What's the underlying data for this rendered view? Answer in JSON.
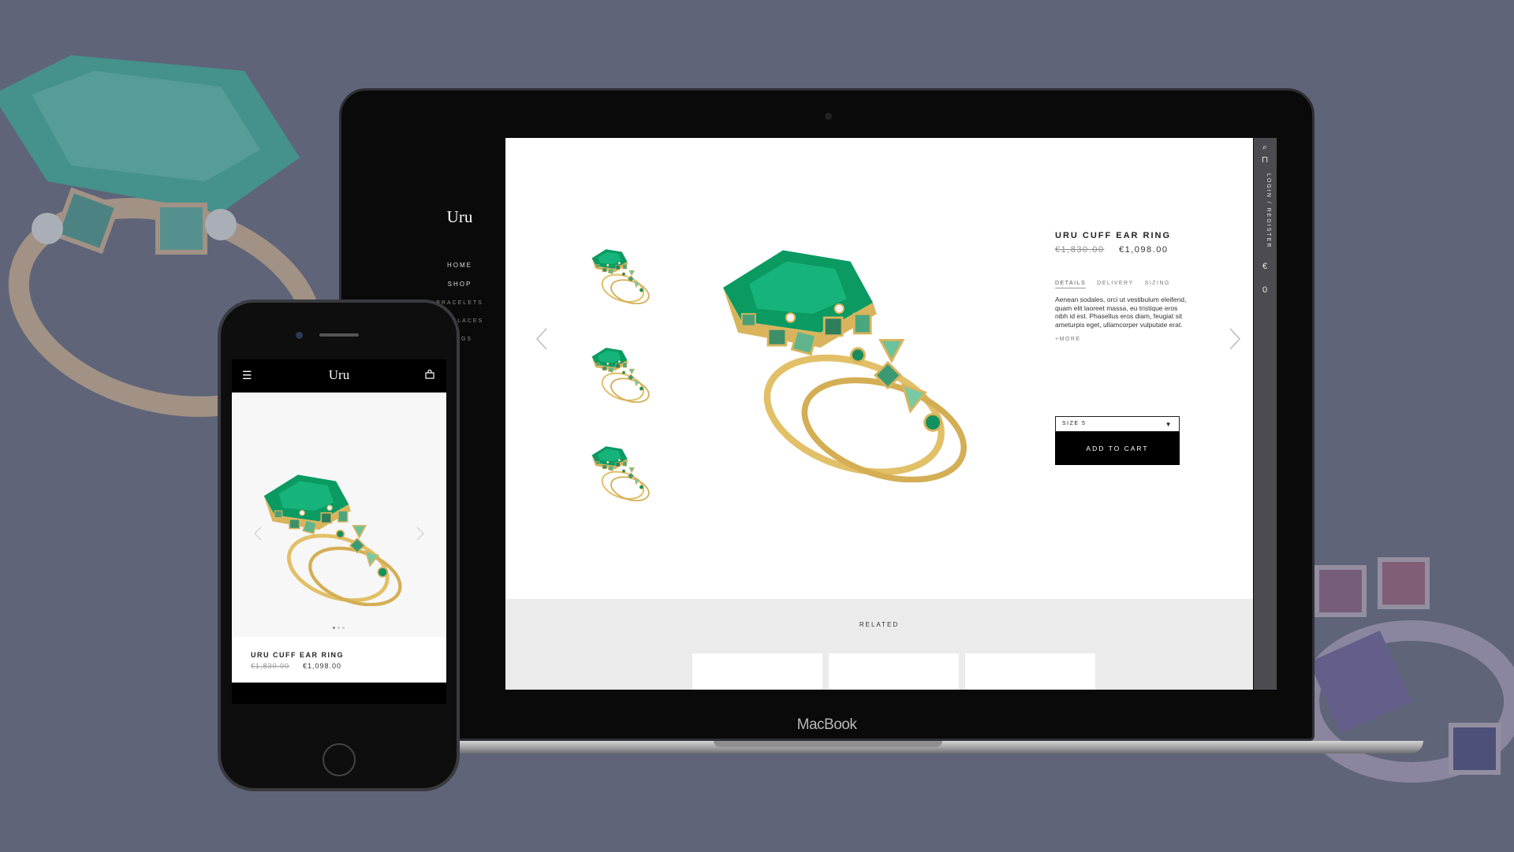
{
  "desktop": {
    "logo": "Uru",
    "nav": [
      {
        "label": "HOME",
        "sub": false
      },
      {
        "label": "SHOP",
        "sub": false
      },
      {
        "label": "BRACELETS",
        "sub": true
      },
      {
        "label": "NECKLACES",
        "sub": true
      },
      {
        "label": "RINGS",
        "sub": true
      }
    ],
    "sidebar_right": {
      "login_text": "LOGIN / REGISTER",
      "currency": "€",
      "cart_count": "0"
    },
    "product": {
      "title": "URU CUFF EAR RING",
      "price_old": "€1,830.00",
      "price_new": "€1,098.00",
      "tabs": [
        "DETAILS",
        "DELIVERY",
        "SIZING"
      ],
      "description": "Aenean sodales, orci ut vestibulum eleifend, quam elit laoreet massa, eu tristique eros nibh id est. Phasellus eros diam, feugiat sit ameturpis eget, ullamcorper vulputate erat.",
      "more": "+MORE",
      "size_label": "SIZE  5",
      "add_to_cart": "ADD TO CART"
    },
    "related_label": "RELATED"
  },
  "laptop_brand": "MacBook",
  "mobile": {
    "logo": "Uru",
    "menu_icon": "menu-icon",
    "bag_icon": "bag-icon",
    "product": {
      "title": "URU CUFF EAR RING",
      "price_old": "€1,830.00",
      "price_new": "€1,098.00"
    }
  },
  "colors": {
    "background": "#5f6479",
    "emerald": "#0fa06a",
    "gold": "#e6c46a"
  }
}
